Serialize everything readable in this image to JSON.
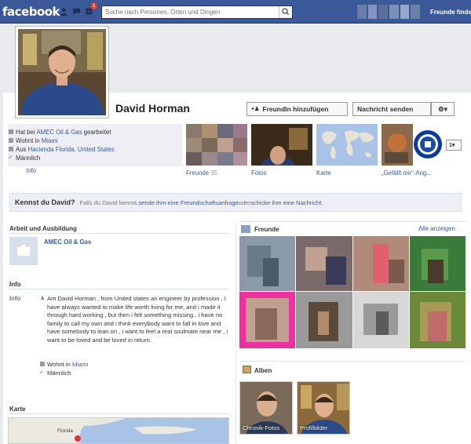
{
  "topbar": {
    "logo": "facebook",
    "notifications_count": "1",
    "search_placeholder": "Suche nach Personen, Orten und Dingen",
    "friends_find": "Freunde finden"
  },
  "profile": {
    "name": "David Horman",
    "add_friend_button": "FreundIn hinzufügen",
    "message_button": "Nachricht senden",
    "more_button": "1"
  },
  "intro": {
    "work_prefix": "Hat bei ",
    "work_company": "AMEC Oil & Gas",
    "work_suffix": " gearbeitet",
    "lives_prefix": "Wohnt in ",
    "lives_city": "Miami",
    "from_prefix": "Aus ",
    "from_place": "Hacienda Florida, United States",
    "gender": "Männlich",
    "info_link": "Info"
  },
  "tiles": {
    "friends_label": "Freunde",
    "friends_count": "35",
    "photos_label": "Fotos",
    "map_label": "Karte",
    "likes_label": "„Gefällt mir“-Ang..."
  },
  "prompt": {
    "title": "Kennst du David?",
    "text1": "Falls du David kennst, ",
    "link1": "sende ihm eine Freundschaftsanfrage",
    "text2": " oder ",
    "link2": "schicke ihm eine Nachricht",
    "text3": "."
  },
  "left": {
    "work_title": "Arbeit und Ausbildung",
    "work_company": "AMEC Oil & Gas",
    "info_title": "Info",
    "info_label": "Info",
    "about": "Am David Horman , from United states an engineer by profession , I have always wanted to make life worth living for me, and i made it through hard working , but then i felt something missing.. i have no family to call my own and i think everybody want to fall in love and have somebody to lean on , i want to feel a real soulmate near me , i want to be loved and be loved in return.",
    "lives_prefix": "Wohnt in ",
    "lives_city": "Miami",
    "gender": "Männlich",
    "map_title": "Karte",
    "map_place": "Florida"
  },
  "right": {
    "friends_title": "Freunde",
    "show_all": "Alle anzeigen",
    "albums_title": "Alben",
    "album1": "Chronik-Fotos",
    "album2": "Profilbilder"
  },
  "colors": {
    "brand": "#3b5998",
    "link": "#3b5998",
    "badge": "#f03d25"
  }
}
